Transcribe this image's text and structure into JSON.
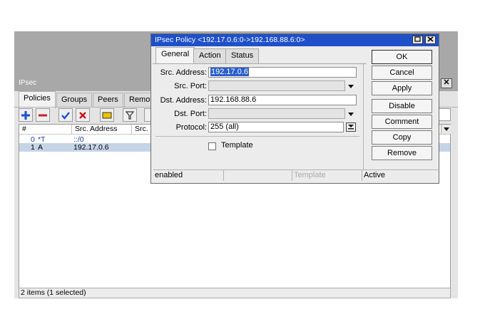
{
  "ipsec_window": {
    "title": "IPsec",
    "close": "✕",
    "tabs": [
      "Policies",
      "Groups",
      "Peers",
      "Remot"
    ],
    "columns": [
      "#",
      "Src. Address",
      "Src."
    ],
    "rows": [
      {
        "num": "0",
        "flag": "*T",
        "src": "::/0"
      },
      {
        "num": "1",
        "flag": "A",
        "src": "192.17.0.6"
      }
    ],
    "status": "2 items (1 selected)"
  },
  "dialog": {
    "title": "IPsec Policy <192.17.0.6:0->192.168.88.6:0>",
    "tabs": [
      "General",
      "Action",
      "Status"
    ],
    "fields": {
      "src_address_label": "Src. Address:",
      "src_address_value": "192.17.0.6",
      "src_port_label": "Src. Port:",
      "dst_address_label": "Dst. Address:",
      "dst_address_value": "192.168.88.6",
      "dst_port_label": "Dst. Port:",
      "protocol_label": "Protocol:",
      "protocol_value": "255 (all)",
      "template_label": "Template"
    },
    "buttons": [
      "OK",
      "Cancel",
      "Apply",
      "Disable",
      "Comment",
      "Copy",
      "Remove"
    ],
    "status": {
      "state": "enabled",
      "template": "Template",
      "active": "Active"
    }
  },
  "colors": {
    "title_active": "#1f50c8",
    "selection": "#2a5ec8",
    "row_selected": "#c6d4e8",
    "add_icon": "#1a4ed8",
    "remove_icon": "#cc2020",
    "check_icon": "#1a4ed8",
    "x_icon": "#cc1010",
    "comment_icon": "#e8c500"
  }
}
